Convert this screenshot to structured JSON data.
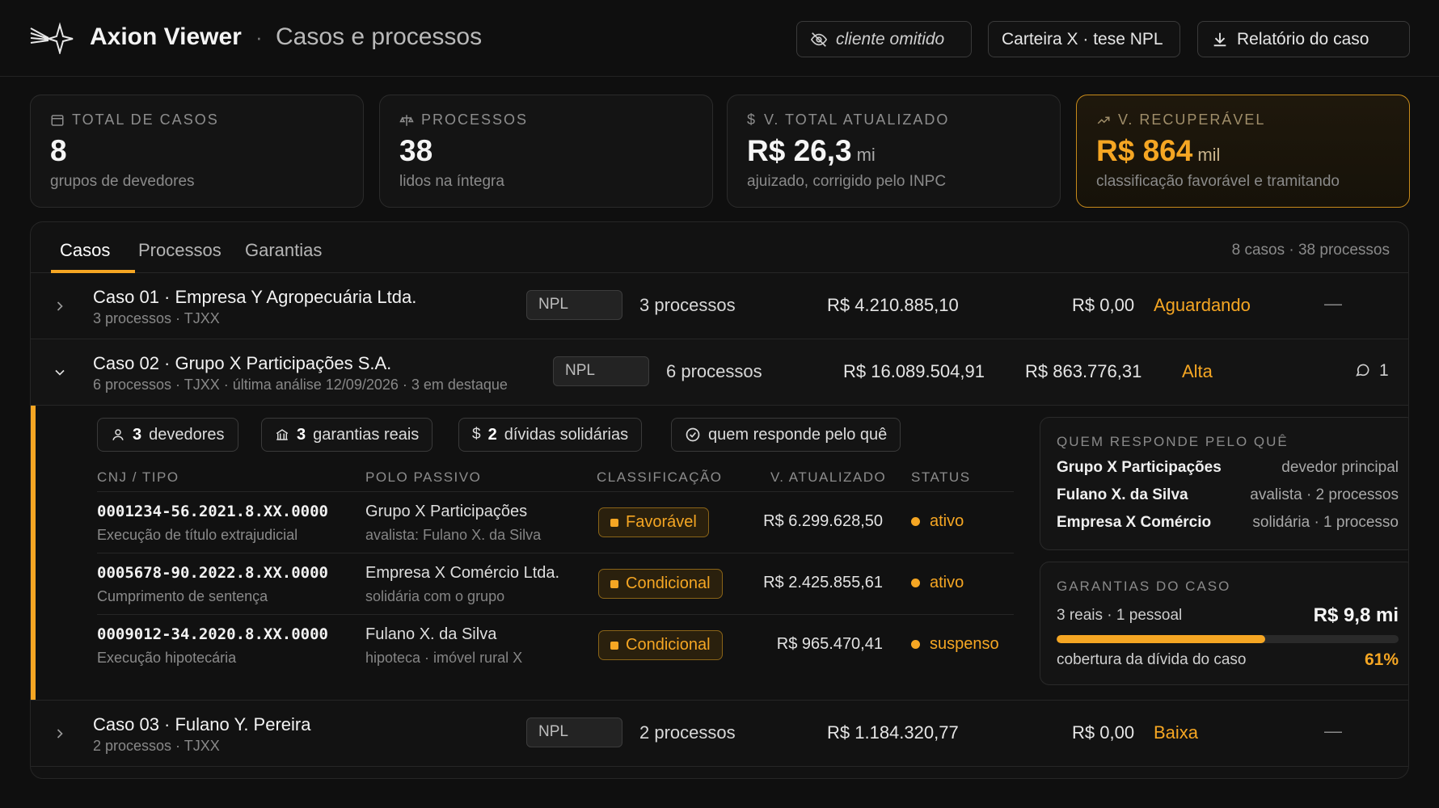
{
  "header": {
    "app_name": "Axion Viewer",
    "separator": "·",
    "page_title": "Casos e processos",
    "client_label": "cliente omitido",
    "portfolio_label": "Carteira X · tese NPL",
    "report_label": "Relatório do caso"
  },
  "stats": [
    {
      "label": "TOTAL DE CASOS",
      "value": "8",
      "unit": "",
      "sub": "grupos de devedores",
      "icon": "folder-icon"
    },
    {
      "label": "PROCESSOS",
      "value": "38",
      "unit": "",
      "sub": "lidos na íntegra",
      "icon": "scale-icon"
    },
    {
      "label": "V. TOTAL ATUALIZADO",
      "value": "R$ 26,3",
      "unit": "mi",
      "sub": "ajuizado, corrigido pelo INPC",
      "icon": "dollar-icon"
    },
    {
      "label": "V. RECUPERÁVEL",
      "value": "R$ 864",
      "unit": "mil",
      "sub": "classificação favorável e tramitando",
      "icon": "trending-up-icon"
    }
  ],
  "tabs": {
    "items": [
      "Casos",
      "Processos",
      "Garantias"
    ],
    "active": "Casos",
    "summary": "8 casos · 38 processos"
  },
  "cases": [
    {
      "title": "Caso 01 · Empresa Y Agropecuária Ltda.",
      "sub": "3 processos · TJXX",
      "tag": "NPL",
      "processes": "3 processos",
      "value": "R$ 4.210.885,10",
      "recoverable": "R$ 0,00",
      "priority": "Aguardando",
      "extra": "—"
    },
    {
      "title": "Caso 02 · Grupo X Participações S.A.",
      "sub": "6 processos · TJXX · última análise 12/09/2026 · 3 em destaque",
      "tag": "NPL",
      "processes": "6 processos",
      "value": "R$ 16.089.504,91",
      "recoverable": "R$ 863.776,31",
      "priority": "Alta",
      "extra": "1"
    },
    {
      "title": "Caso 03 · Fulano Y. Pereira",
      "sub": "2 processos · TJXX",
      "tag": "NPL",
      "processes": "2 processos",
      "value": "R$ 1.184.320,77",
      "recoverable": "R$ 0,00",
      "priority": "Baixa",
      "extra": "—"
    }
  ],
  "expanded": {
    "chips": [
      {
        "count": "3",
        "label": "devedores",
        "icon": "user-icon"
      },
      {
        "count": "3",
        "label": "garantias reais",
        "icon": "bank-icon"
      },
      {
        "count": "2",
        "label": "dívidas solidárias",
        "icon": "dollar-icon"
      },
      {
        "count": "",
        "label": "quem responde pelo quê",
        "icon": "check-circle-icon"
      }
    ],
    "columns": [
      "CNJ / TIPO",
      "POLO PASSIVO",
      "CLASSIFICAÇÃO",
      "V. ATUALIZADO",
      "STATUS"
    ],
    "rows": [
      {
        "cnj": "0001234-56.2021.8.XX.0000",
        "tipo": "Execução de título extrajudicial",
        "polo": "Grupo X Participações",
        "polo_sub": "avalista: Fulano X. da Silva",
        "classificacao": "Favorável",
        "valor": "R$ 6.299.628,50",
        "status": "ativo"
      },
      {
        "cnj": "0005678-90.2022.8.XX.0000",
        "tipo": "Cumprimento de sentença",
        "polo": "Empresa X Comércio Ltda.",
        "polo_sub": "solidária com o grupo",
        "classificacao": "Condicional",
        "valor": "R$ 2.425.855,61",
        "status": "ativo"
      },
      {
        "cnj": "0009012-34.2020.8.XX.0000",
        "tipo": "Execução hipotecária",
        "polo": "Fulano X. da Silva",
        "polo_sub": "hipoteca · imóvel rural X",
        "classificacao": "Condicional",
        "valor": "R$ 965.470,41",
        "status": "suspenso"
      }
    ],
    "responsibility": {
      "title": "QUEM RESPONDE PELO QUÊ",
      "items": [
        {
          "name": "Grupo X Participações",
          "role": "devedor principal"
        },
        {
          "name": "Fulano X. da Silva",
          "role": "avalista · 2 processos"
        },
        {
          "name": "Empresa X Comércio",
          "role": "solidária · 1 processo"
        }
      ]
    },
    "guarantees": {
      "title": "GARANTIAS DO CASO",
      "summary": "3 reais · 1 pessoal",
      "total": "R$ 9,8 mi",
      "coverage_label": "cobertura da dívida do caso",
      "coverage_pct": "61%",
      "coverage_value": 0.61
    }
  },
  "colors": {
    "accent": "#f5a623",
    "background": "#0f0f0f",
    "panel": "#121212"
  }
}
